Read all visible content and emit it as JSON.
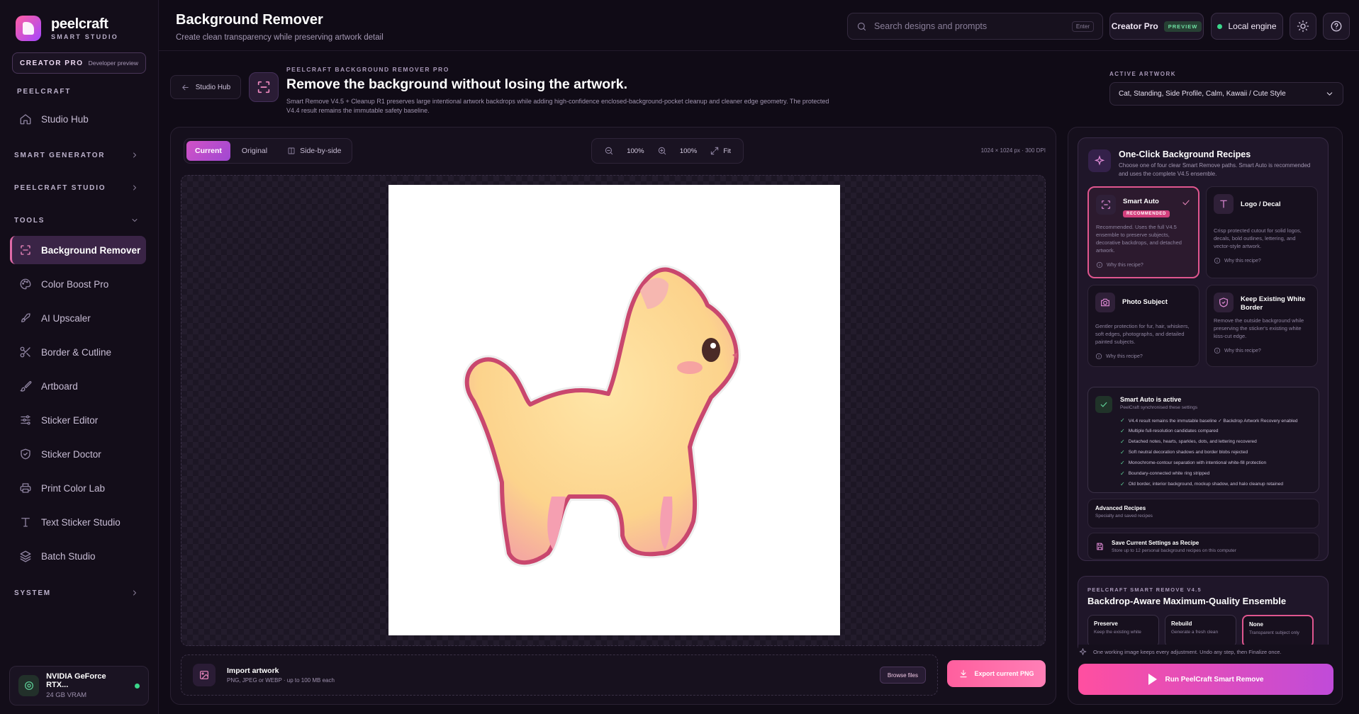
{
  "brand": {
    "name": "peelcraft",
    "sub": "SMART STUDIO",
    "plan": "CREATOR PRO",
    "plan_note": "Developer preview"
  },
  "sidebar": {
    "section": "PEELCRAFT",
    "hub": "Studio Hub",
    "groups": {
      "smart_generator": "SMART GENERATOR",
      "studio": "PEELCRAFT STUDIO",
      "tools": "TOOLS",
      "system": "SYSTEM"
    },
    "tools": [
      {
        "label": "Background Remover",
        "icon": "scan-icon"
      },
      {
        "label": "Color Boost Pro",
        "icon": "palette-icon"
      },
      {
        "label": "AI Upscaler",
        "icon": "rocket-icon"
      },
      {
        "label": "Border & Cutline",
        "icon": "scissors-icon"
      },
      {
        "label": "Artboard",
        "icon": "brush-icon"
      },
      {
        "label": "Sticker Editor",
        "icon": "sliders-icon"
      },
      {
        "label": "Sticker Doctor",
        "icon": "shield-icon"
      },
      {
        "label": "Print Color Lab",
        "icon": "printer-icon"
      },
      {
        "label": "Text Sticker Studio",
        "icon": "type-icon"
      },
      {
        "label": "Batch Studio",
        "icon": "layers-icon"
      }
    ],
    "gpu": {
      "name": "NVIDIA GeForce RTX...",
      "mem": "24 GB VRAM"
    }
  },
  "header": {
    "title": "Background Remover",
    "subtitle": "Create clean transparency while preserving artwork detail",
    "search_placeholder": "Search designs and prompts",
    "search_key": "Enter",
    "creator": "Creator Pro",
    "creator_badge": "PREVIEW",
    "engine": "Local engine"
  },
  "tool": {
    "back": "Studio Hub",
    "eyebrow": "PEELCRAFT BACKGROUND REMOVER PRO",
    "title": "Remove the background without losing the artwork.",
    "desc": "Smart Remove V4.5 + Cleanup R1 preserves large intentional artwork backdrops while adding high-confidence enclosed-background-pocket cleanup and cleaner edge geometry. The protected V4.4 result remains the immutable safety baseline.",
    "active_label": "ACTIVE ARTWORK",
    "active_value": "Cat, Standing, Side Profile, Calm, Kawaii / Cute Style"
  },
  "canvas": {
    "tabs": [
      "Current",
      "Original",
      "Side-by-side"
    ],
    "zoom_a": "100%",
    "zoom_b": "100%",
    "fit": "Fit",
    "dims": "1024 × 1024 px · 300 DPI",
    "import_title": "Import artwork",
    "import_sub": "PNG, JPEG or WEBP · up to 100 MB each",
    "browse": "Browse files",
    "export": "Export current PNG"
  },
  "recipes": {
    "title": "One-Click Background Recipes",
    "desc": "Choose one of four clear Smart Remove paths. Smart Auto is recommended and uses the complete V4.5 ensemble.",
    "cards": [
      {
        "title": "Smart Auto",
        "badge": "RECOMMENDED",
        "desc": "Recommended. Uses the full V4.5 ensemble to preserve subjects, decorative backdrops, and detached artwork.",
        "why": "Why this recipe?"
      },
      {
        "title": "Logo / Decal",
        "desc": "Crisp protected cutout for solid logos, decals, bold outlines, lettering, and vector-style artwork.",
        "why": "Why this recipe?"
      },
      {
        "title": "Photo Subject",
        "desc": "Gentler protection for fur, hair, whiskers, soft edges, photographs, and detailed painted subjects.",
        "why": "Why this recipe?"
      },
      {
        "title": "Keep Existing White Border",
        "desc": "Remove the outside background while preserving the sticker's existing white kiss-cut edge.",
        "why": "Why this recipe?"
      }
    ],
    "active": {
      "title": "Smart Auto is active",
      "sub": "PeelCraft synchronised these settings",
      "items": [
        "V4.4 result remains the immutable baseline  ✓ Backdrop Artwork Recovery enabled",
        "Multiple full-resolution candidates compared",
        "Detached notes, hearts, sparkles, dots, and lettering recovered",
        "Soft neutral decoration shadows and border blobs rejected",
        "Monochrome-contour separation with intentional white-fill protection",
        "Boundary-connected white ring stripped",
        "Old border, interior background, mockup shadow, and halo cleanup retained"
      ]
    },
    "advanced_title": "Advanced Recipes",
    "advanced_sub": "Specialty and saved recipes",
    "save_title": "Save Current Settings as Recipe",
    "save_sub": "Store up to 12 personal background recipes on this computer"
  },
  "ensemble": {
    "eyebrow": "PEELCRAFT SMART REMOVE V4.5",
    "title": "Backdrop-Aware Maximum-Quality Ensemble",
    "options": [
      {
        "title": "Preserve",
        "sub": "Keep the existing white"
      },
      {
        "title": "Rebuild",
        "sub": "Generate a fresh clean"
      },
      {
        "title": "None",
        "sub": "Transparent subject only"
      }
    ]
  },
  "footer": {
    "note": "One working image keeps every adjustment. Undo any step, then Finalize once.",
    "run": "Run PeelCraft Smart Remove"
  },
  "colors": {
    "accent": "#e0568f",
    "bg": "#100b16",
    "success": "#3bd68a"
  }
}
